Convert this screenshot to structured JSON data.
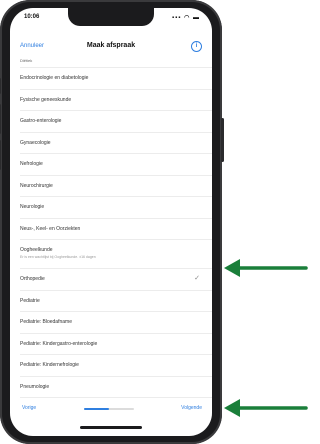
{
  "status_bar": {
    "time": "10:06",
    "icons": "▪▪▪ ◠ ▬"
  },
  "nav": {
    "back_label": "Annuleer",
    "title": "Maak afspraak",
    "info_icon": "info-icon"
  },
  "list": {
    "items": [
      {
        "label": "Diëtiek",
        "cut": true
      },
      {
        "label": "Endocrinologie en diabetologie"
      },
      {
        "label": "Fysische geneeskunde"
      },
      {
        "label": "Gastro-enterologie"
      },
      {
        "label": "Gynaecologie"
      },
      {
        "label": "Nefrologie"
      },
      {
        "label": "Neurochirurgie"
      },
      {
        "label": "Neurologie"
      },
      {
        "label": "Neus-, Keel- en Oorziekten"
      },
      {
        "label": "Oogheelkunde",
        "sub": "Er is een wachtlijst bij Oogheelkunde. ±16 dagen"
      },
      {
        "label": "Orthopedie",
        "selected": true
      },
      {
        "label": "Pediatrie"
      },
      {
        "label": "Pediatrie: Bloedafname"
      },
      {
        "label": "Pediatrie: Kindergastro-enterologie"
      },
      {
        "label": "Pediatrie: Kindernefrologie"
      },
      {
        "label": "Pneumologie"
      }
    ],
    "check_glyph": "✓"
  },
  "bottom": {
    "prev_label": "Vorige",
    "next_label": "Volgende",
    "progress": 0.5
  },
  "colors": {
    "accent": "#2f7fe0",
    "arrow": "#1a7f3a",
    "phone": "#1b1b1d"
  }
}
